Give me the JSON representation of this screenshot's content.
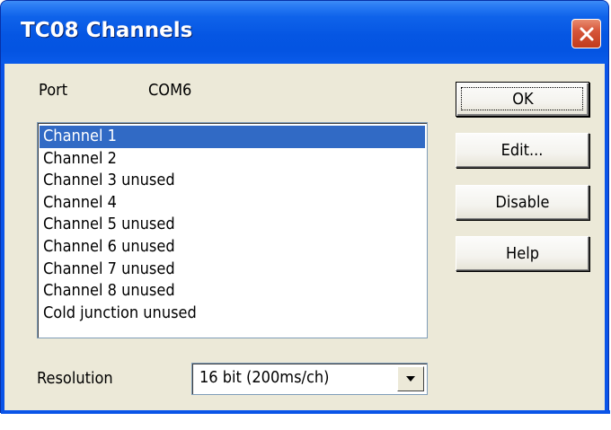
{
  "window": {
    "title": "TC08 Channels",
    "close_icon": "close-icon"
  },
  "port": {
    "label": "Port",
    "value": "COM6"
  },
  "channels": {
    "items": [
      {
        "label": "Channel 1",
        "selected": true
      },
      {
        "label": "Channel 2",
        "selected": false
      },
      {
        "label": "Channel 3 unused",
        "selected": false
      },
      {
        "label": "Channel 4",
        "selected": false
      },
      {
        "label": "Channel 5 unused",
        "selected": false
      },
      {
        "label": "Channel 6 unused",
        "selected": false
      },
      {
        "label": "Channel 7 unused",
        "selected": false
      },
      {
        "label": "Channel 8 unused",
        "selected": false
      },
      {
        "label": "Cold junction unused",
        "selected": false
      }
    ]
  },
  "resolution": {
    "label": "Resolution",
    "value": "16 bit (200ms/ch)",
    "dropdown_icon": "chevron-down-icon"
  },
  "buttons": {
    "ok": "OK",
    "edit": "Edit...",
    "disable": "Disable",
    "help": "Help"
  },
  "colors": {
    "titlebar": "#0454e2",
    "selection": "#316ac5",
    "dialog_bg": "#ece9d8",
    "close_button": "#d6563a"
  }
}
